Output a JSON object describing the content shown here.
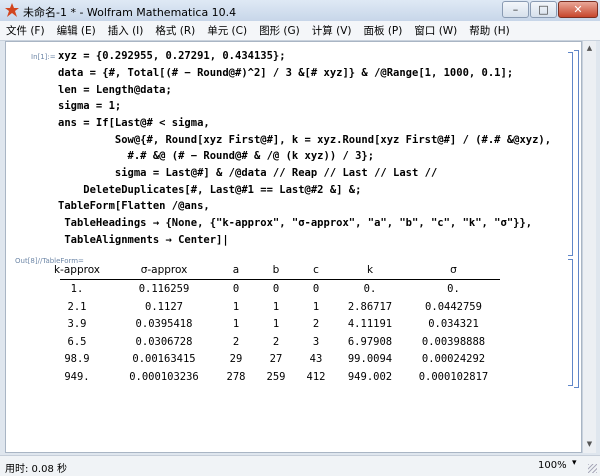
{
  "window": {
    "title": "未命名-1 * - Wolfram Mathematica 10.4",
    "buttons": [
      "–",
      "□",
      "✕"
    ]
  },
  "menu": [
    "文件 (F)",
    "编辑 (E)",
    "插入 (I)",
    "格式 (R)",
    "单元 (C)",
    "图形 (G)",
    "计算 (V)",
    "面板 (P)",
    "窗口 (W)",
    "帮助 (H)"
  ],
  "cells": {
    "input_label": "In[1]:=",
    "input_lines": [
      "xyz = {0.292955, 0.27291, 0.434135};",
      "data = {#, Total[(# − Round@#)^2] / 3 &[# xyz]} & /@Range[1, 1000, 0.1];",
      "len = Length@data;",
      "sigma = 1;",
      "ans = If[Last@# < sigma,",
      "         Sow@{#, Round[xyz First@#], k = xyz.Round[xyz First@#] / (#.# &@xyz),",
      "           #.# &@ (# − Round@# & /@ (k xyz)) / 3};",
      "         sigma = Last@#] & /@data // Reap // Last // Last //",
      "    DeleteDuplicates[#, Last@#1 == Last@#2 &] &;",
      "TableForm[Flatten /@ans,",
      " TableHeadings → {None, {\"k-approx\", \"σ-approx\", \"a\", \"b\", \"c\", \"k\", \"σ\"}},",
      " TableAlignments → Center]|"
    ],
    "output_label": "Out[8]//TableForm="
  },
  "table": {
    "headers": [
      "k-approx",
      "σ-approx",
      "a",
      "b",
      "c",
      "k",
      "σ"
    ],
    "rows": [
      [
        "1.",
        "0.116259",
        "0",
        "0",
        "0",
        "0.",
        "0."
      ],
      [
        "2.1",
        "0.1127",
        "1",
        "1",
        "1",
        "2.86717",
        "0.0442759"
      ],
      [
        "3.9",
        "0.0395418",
        "1",
        "1",
        "2",
        "4.11191",
        "0.034321"
      ],
      [
        "6.5",
        "0.0306728",
        "2",
        "2",
        "3",
        "6.97908",
        "0.00398888"
      ],
      [
        "98.9",
        "0.00163415",
        "29",
        "27",
        "43",
        "99.0094",
        "0.00024292"
      ],
      [
        "949.",
        "0.000103236",
        "278",
        "259",
        "412",
        "949.002",
        "0.000102817"
      ]
    ]
  },
  "status": {
    "text": "用时: 0.08 秒",
    "zoom": "100%"
  }
}
